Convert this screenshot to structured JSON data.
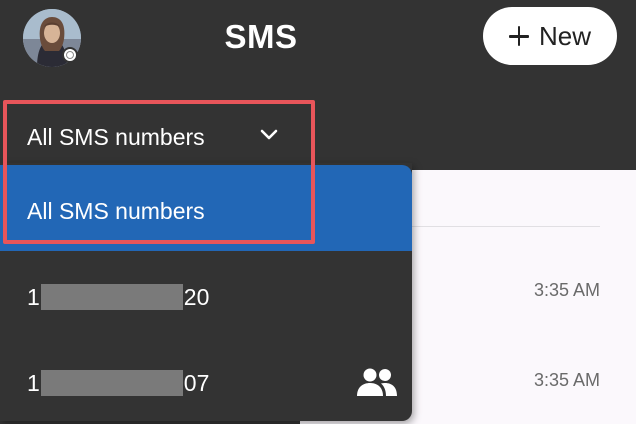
{
  "header": {
    "title": "SMS",
    "new_button_label": "New"
  },
  "filter": {
    "selected_label": "All SMS numbers"
  },
  "dropdown": {
    "options": [
      {
        "label": "All SMS numbers",
        "selected": true
      },
      {
        "prefix": "1",
        "suffix": "20",
        "redacted": true
      },
      {
        "prefix": "1",
        "suffix": "07",
        "redacted": true,
        "icon": "group-icon"
      }
    ]
  },
  "conversations": {
    "times": [
      "3:35 AM",
      "3:35 AM"
    ]
  },
  "colors": {
    "background": "#333333",
    "accent_selected": "#2267b6",
    "highlight_border": "#e8555a",
    "content_panel": "#fbf8fc",
    "time_text": "#6a6a6a"
  }
}
